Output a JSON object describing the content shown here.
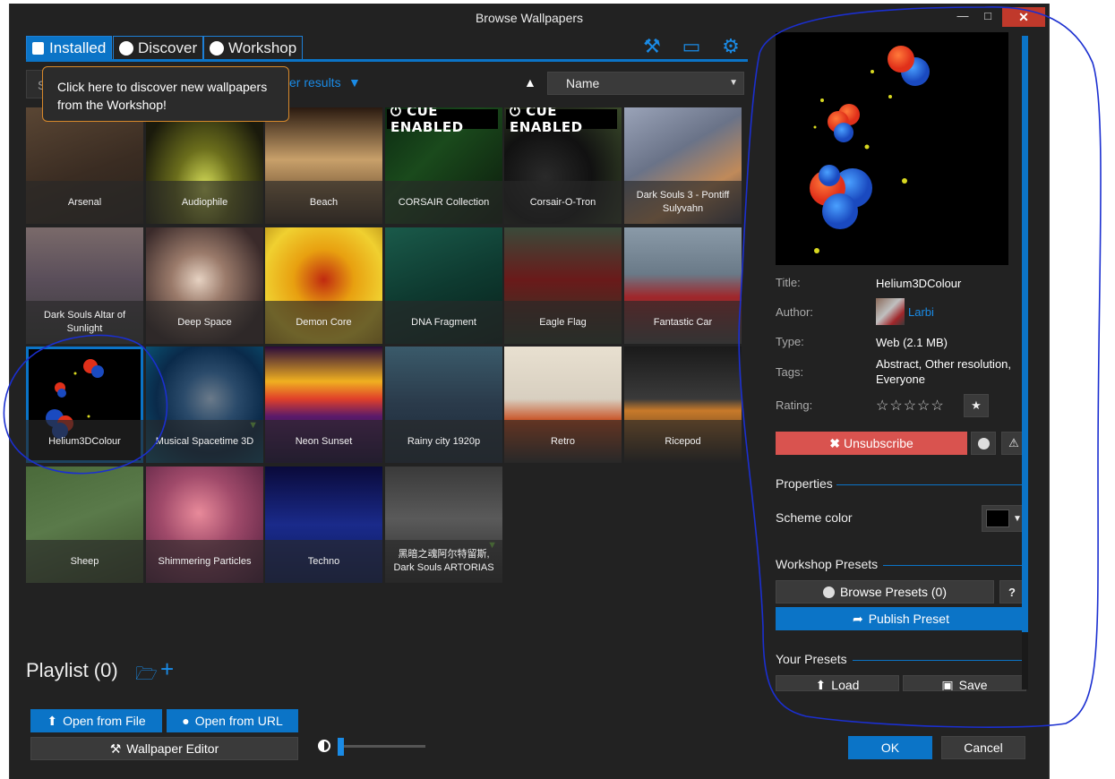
{
  "window": {
    "title": "Browse Wallpapers"
  },
  "tabs": [
    {
      "label": "Installed",
      "icon": "save-icon",
      "active": true
    },
    {
      "label": "Discover",
      "icon": "compass-icon",
      "active": false
    },
    {
      "label": "Workshop",
      "icon": "steam-icon",
      "active": false
    }
  ],
  "top_icons": [
    "tools-icon",
    "monitor-icon",
    "gear-icon"
  ],
  "tooltip": {
    "text": "Click here to discover new wallpapers from the Workshop!"
  },
  "search": {
    "placeholder": "S"
  },
  "filter": {
    "label": "er results"
  },
  "sort": {
    "selected": "Name"
  },
  "wallpapers": [
    {
      "name": "Arsenal",
      "bg": "linear-gradient(160deg,#5a4634 0%,#3a2c22 55%,#2a221c 100%)"
    },
    {
      "name": "Audiophile",
      "bg": "radial-gradient(ellipse at 50% 70%,#d8e05a 0%,#6b6e1c 35%,#1a1a0c 80%)"
    },
    {
      "name": "Beach",
      "bg": "linear-gradient(180deg,#2a1a10 0%,#c8a06a 45%,#8a6a44 70%,#3a2a1c 100%)"
    },
    {
      "name": "CORSAIR Collection",
      "bg": "linear-gradient(135deg,#0c2a12 0%,#1a4a1c 40%,#0c1a0c 100%)",
      "cue": true
    },
    {
      "name": "Corsair-O-Tron",
      "bg": "radial-gradient(circle at 35% 60%,#2a2a2a 0%,#111 45%,#3a4a2a 100%)",
      "cue": true
    },
    {
      "name": "Dark Souls 3 - Pontiff Sulyvahn",
      "bg": "linear-gradient(150deg,#9aa3b8 0%,#6a7388 40%,#c08a5a 70%,#3a3a4a 100%)"
    },
    {
      "name": "Dark Souls Altar of Sunlight",
      "bg": "linear-gradient(180deg,#7a6a6a 0%,#5a4e5a 45%,#3a3a3a 100%)"
    },
    {
      "name": "Deep Space",
      "bg": "radial-gradient(circle at 45% 45%,#e6d2c2 0%,#9a7a6a 30%,#3a2a2a 75%)"
    },
    {
      "name": "Demon Core",
      "bg": "radial-gradient(circle at 50% 45%,#c02a10 0%,#e8a010 35%,#f0d030 70%,#b89018 100%)"
    },
    {
      "name": "DNA Fragment",
      "bg": "linear-gradient(160deg,#1a5a4a 0%,#0e3a30 50%,#08201a 100%)"
    },
    {
      "name": "Eagle Flag",
      "bg": "linear-gradient(180deg,#3a4a3a 0%,#6a1a1a 45%,#2a3a2a 100%)"
    },
    {
      "name": "Fantastic Car",
      "bg": "linear-gradient(180deg,#8a9aa8 0%,#6a7a88 40%,#a0262a 60%,#4a4a4a 100%)"
    },
    {
      "name": "Helium3DColour",
      "bg": "#000000",
      "selected": true
    },
    {
      "name": "Musical Spacetime 3D",
      "bg": "radial-gradient(circle at 55% 45%,#6a7a8a 0%,#2a4a6a 30%,#0a2a4a 60%,#0a5a7a 100%)",
      "trophy": true
    },
    {
      "name": "Neon Sunset",
      "bg": "linear-gradient(180deg,#2a0a3a 0%,#f0b020 30%,#e0402a 45%,#5a1a6a 60%,#1a0a3a 100%)"
    },
    {
      "name": "Rainy city 1920p",
      "bg": "linear-gradient(180deg,#3a5a6a 0%,#2a3a4a 50%,#1a2a3a 100%)"
    },
    {
      "name": "Retro",
      "bg": "linear-gradient(180deg,#e8e0d0 0%,#d8cfc0 45%,#c84a1a 65%,#2a2a2a 100%)"
    },
    {
      "name": "Ricepod",
      "bg": "linear-gradient(180deg,#1a1a1a 0%,#3a3a3a 45%,#c87a2a 55%,#1a1a1a 100%)"
    },
    {
      "name": "Sheep",
      "bg": "linear-gradient(160deg,#4a6a3a 0%,#5a7a4a 45%,#3a4a2a 100%)"
    },
    {
      "name": "Shimmering Particles",
      "bg": "radial-gradient(circle at 45% 40%,#e88a9a 0%,#a04a6a 40%,#4a1a3a 100%)"
    },
    {
      "name": "Techno",
      "bg": "linear-gradient(180deg,#0a0a3a 0%,#1a2a8a 50%,#0a1a5a 100%)"
    },
    {
      "name": "黑暗之魂阿尔特留斯, Dark Souls ARTORIAS",
      "bg": "linear-gradient(180deg,#3a3a3a 0%,#5a5a5a 45%,#2a2a2a 100%)",
      "trophy": true
    }
  ],
  "playlist": {
    "label": "Playlist (0)"
  },
  "buttons": {
    "open_file": "Open from File",
    "open_url": "Open from URL",
    "editor": "Wallpaper Editor",
    "ok": "OK",
    "cancel": "Cancel"
  },
  "details": {
    "title_label": "Title:",
    "title_value": "Helium3DColour",
    "author_label": "Author:",
    "author_value": "Larbi",
    "type_label": "Type:",
    "type_value": "Web (2.1 MB)",
    "tags_label": "Tags:",
    "tags_value": "Abstract, Other resolution, Everyone",
    "rating_label": "Rating:",
    "rating_stars": "☆☆☆☆☆",
    "unsubscribe": "Unsubscribe"
  },
  "properties": {
    "heading": "Properties",
    "scheme_color_label": "Scheme color",
    "scheme_color_value": "#000000"
  },
  "workshop_presets": {
    "heading": "Workshop Presets",
    "browse": "Browse Presets (0)",
    "publish": "Publish Preset"
  },
  "your_presets": {
    "heading": "Your Presets",
    "load": "Load",
    "save": "Save"
  },
  "colors": {
    "accent": "#0b74c7",
    "danger": "#d9534f",
    "background": "#222222"
  }
}
